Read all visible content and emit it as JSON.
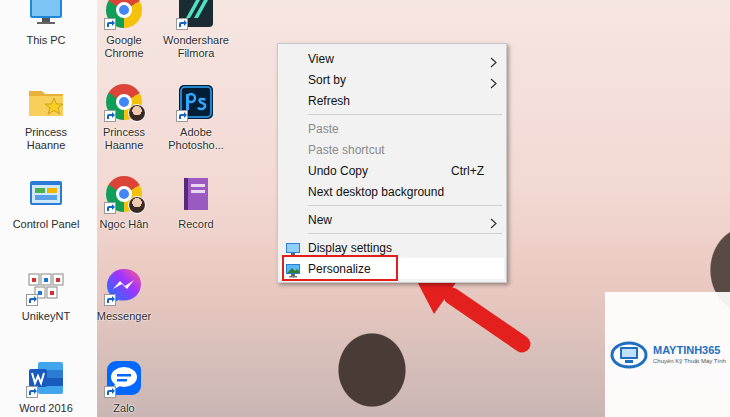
{
  "desktop": {
    "columns": [
      {
        "icons": [
          {
            "label": "This PC",
            "kind": "pc",
            "shortcut": false
          },
          {
            "label": "Princess Haanne",
            "kind": "folder-star",
            "shortcut": false
          },
          {
            "label": "Control Panel",
            "kind": "control-panel",
            "shortcut": false
          },
          {
            "label": "UnikeyNT",
            "kind": "unikey",
            "shortcut": true
          },
          {
            "label": "Word 2016",
            "kind": "word",
            "shortcut": true
          }
        ]
      },
      {
        "icons": [
          {
            "label": "Google Chrome",
            "kind": "chrome",
            "shortcut": true
          },
          {
            "label": "Princess Haanne",
            "kind": "chrome-avatar",
            "shortcut": true
          },
          {
            "label": "Ngọc Hân",
            "kind": "chrome-avatar",
            "shortcut": true
          },
          {
            "label": "Messenger",
            "kind": "messenger",
            "shortcut": true
          },
          {
            "label": "Zalo",
            "kind": "zalo",
            "shortcut": true
          }
        ]
      },
      {
        "icons": [
          {
            "label": "Wondershare Filmora",
            "kind": "filmora",
            "shortcut": true
          },
          {
            "label": "Adobe Photosho...",
            "kind": "photoshop",
            "shortcut": true
          },
          {
            "label": "Record",
            "kind": "record",
            "shortcut": false
          }
        ]
      }
    ]
  },
  "context_menu": {
    "items": [
      {
        "kind": "item",
        "label": "View",
        "submenu": true,
        "disabled": false,
        "highlighted": false,
        "annotated": false
      },
      {
        "kind": "item",
        "label": "Sort by",
        "submenu": true,
        "disabled": false,
        "highlighted": false,
        "annotated": false
      },
      {
        "kind": "item",
        "label": "Refresh",
        "submenu": false,
        "disabled": false,
        "highlighted": false,
        "annotated": false
      },
      {
        "kind": "separator"
      },
      {
        "kind": "item",
        "label": "Paste",
        "submenu": false,
        "disabled": true,
        "highlighted": false,
        "annotated": false
      },
      {
        "kind": "item",
        "label": "Paste shortcut",
        "submenu": false,
        "disabled": true,
        "highlighted": false,
        "annotated": false
      },
      {
        "kind": "item",
        "label": "Undo Copy",
        "accelerator": "Ctrl+Z",
        "submenu": false,
        "disabled": false,
        "highlighted": false,
        "annotated": false
      },
      {
        "kind": "item",
        "label": "Next desktop background",
        "submenu": false,
        "disabled": false,
        "highlighted": false,
        "annotated": false
      },
      {
        "kind": "separator"
      },
      {
        "kind": "item",
        "label": "New",
        "submenu": true,
        "disabled": false,
        "highlighted": false,
        "annotated": false
      },
      {
        "kind": "separator"
      },
      {
        "kind": "display",
        "label": "Display settings",
        "submenu": false,
        "disabled": false,
        "highlighted": false,
        "annotated": false
      },
      {
        "kind": "personalize",
        "label": "Personalize",
        "submenu": false,
        "disabled": false,
        "highlighted": true,
        "annotated": true
      }
    ]
  },
  "watermark": {
    "brand": "MAYTINH365",
    "tagline": "Chuyên Kỹ Thuật Máy Tính"
  }
}
